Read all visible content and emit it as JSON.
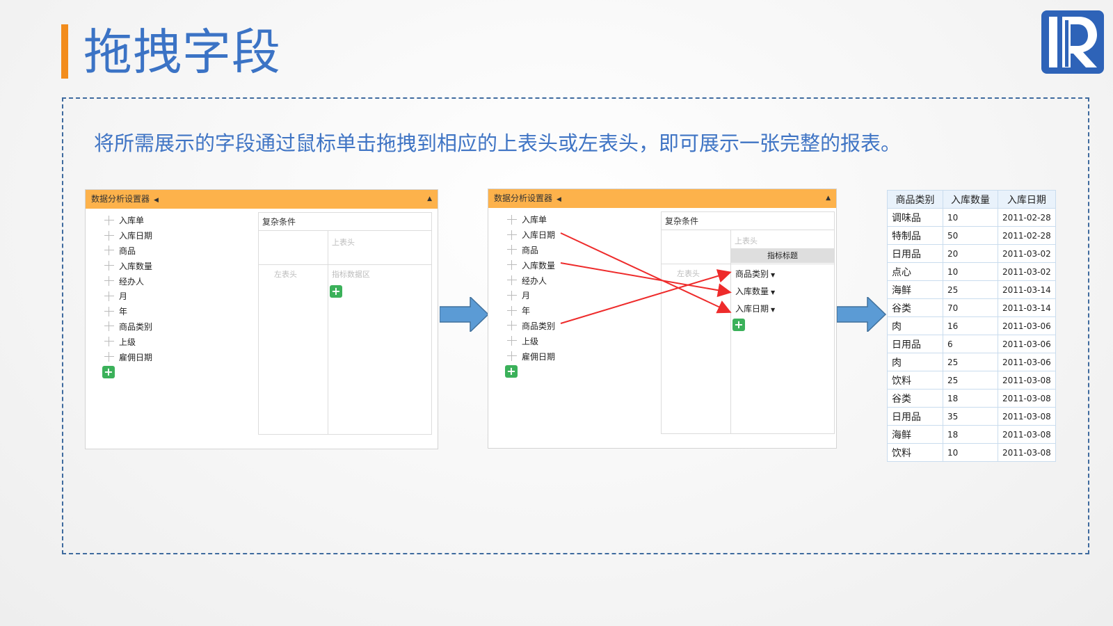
{
  "slide": {
    "title": "拖拽字段",
    "subtitle": "将所需展示的字段通过鼠标单击拖拽到相应的上表头或左表头，即可展示一张完整的报表。",
    "accent_color": "#f28c1c",
    "title_color": "#3b73c5",
    "logo_icon": "raqsoft-r-logo"
  },
  "panel_before": {
    "header": "数据分析设置器",
    "fields": [
      "入库单",
      "入库日期",
      "商品",
      "入库数量",
      "经办人",
      "月",
      "年",
      "商品类别",
      "上级",
      "雇佣日期"
    ],
    "condition": "复杂条件",
    "top_header_placeholder": "上表头",
    "left_header_placeholder": "左表头",
    "data_area_placeholder": "指标数据区"
  },
  "panel_after": {
    "header": "数据分析设置器",
    "fields": [
      "入库单",
      "入库日期",
      "商品",
      "入库数量",
      "经办人",
      "月",
      "年",
      "商品类别",
      "上级",
      "雇佣日期"
    ],
    "condition": "复杂条件",
    "top_header_placeholder": "上表头",
    "left_header_placeholder": "左表头",
    "index_title": "指标标题",
    "dropped_fields": [
      "商品类别",
      "入库数量",
      "入库日期"
    ]
  },
  "result_table": {
    "columns": [
      "商品类别",
      "入库数量",
      "入库日期"
    ],
    "rows": [
      [
        "调味品",
        "10",
        "2011-02-28"
      ],
      [
        "特制品",
        "50",
        "2011-02-28"
      ],
      [
        "日用品",
        "20",
        "2011-03-02"
      ],
      [
        "点心",
        "10",
        "2011-03-02"
      ],
      [
        "海鲜",
        "25",
        "2011-03-14"
      ],
      [
        "谷类",
        "70",
        "2011-03-14"
      ],
      [
        "肉",
        "16",
        "2011-03-06"
      ],
      [
        "日用品",
        "6",
        "2011-03-06"
      ],
      [
        "肉",
        "25",
        "2011-03-06"
      ],
      [
        "饮料",
        "25",
        "2011-03-08"
      ],
      [
        "谷类",
        "18",
        "2011-03-08"
      ],
      [
        "日用品",
        "35",
        "2011-03-08"
      ],
      [
        "海鲜",
        "18",
        "2011-03-08"
      ],
      [
        "饮料",
        "10",
        "2011-03-08"
      ]
    ]
  }
}
